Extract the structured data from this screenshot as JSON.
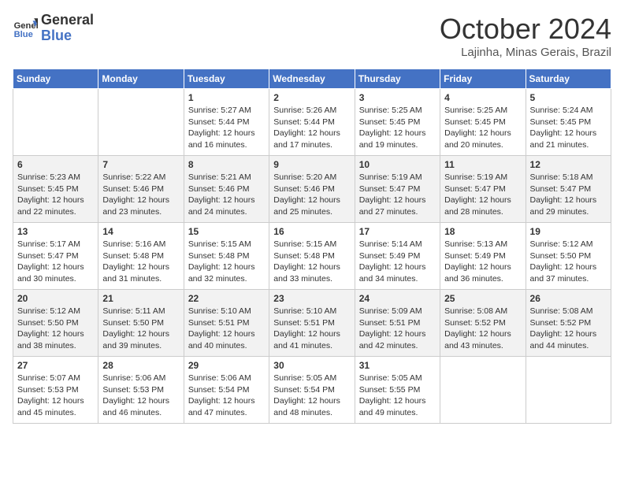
{
  "header": {
    "logo_line1": "General",
    "logo_line2": "Blue",
    "month": "October 2024",
    "location": "Lajinha, Minas Gerais, Brazil"
  },
  "days_of_week": [
    "Sunday",
    "Monday",
    "Tuesday",
    "Wednesday",
    "Thursday",
    "Friday",
    "Saturday"
  ],
  "weeks": [
    [
      {
        "day": "",
        "info": ""
      },
      {
        "day": "",
        "info": ""
      },
      {
        "day": "1",
        "info": "Sunrise: 5:27 AM\nSunset: 5:44 PM\nDaylight: 12 hours and 16 minutes."
      },
      {
        "day": "2",
        "info": "Sunrise: 5:26 AM\nSunset: 5:44 PM\nDaylight: 12 hours and 17 minutes."
      },
      {
        "day": "3",
        "info": "Sunrise: 5:25 AM\nSunset: 5:45 PM\nDaylight: 12 hours and 19 minutes."
      },
      {
        "day": "4",
        "info": "Sunrise: 5:25 AM\nSunset: 5:45 PM\nDaylight: 12 hours and 20 minutes."
      },
      {
        "day": "5",
        "info": "Sunrise: 5:24 AM\nSunset: 5:45 PM\nDaylight: 12 hours and 21 minutes."
      }
    ],
    [
      {
        "day": "6",
        "info": "Sunrise: 5:23 AM\nSunset: 5:45 PM\nDaylight: 12 hours and 22 minutes."
      },
      {
        "day": "7",
        "info": "Sunrise: 5:22 AM\nSunset: 5:46 PM\nDaylight: 12 hours and 23 minutes."
      },
      {
        "day": "8",
        "info": "Sunrise: 5:21 AM\nSunset: 5:46 PM\nDaylight: 12 hours and 24 minutes."
      },
      {
        "day": "9",
        "info": "Sunrise: 5:20 AM\nSunset: 5:46 PM\nDaylight: 12 hours and 25 minutes."
      },
      {
        "day": "10",
        "info": "Sunrise: 5:19 AM\nSunset: 5:47 PM\nDaylight: 12 hours and 27 minutes."
      },
      {
        "day": "11",
        "info": "Sunrise: 5:19 AM\nSunset: 5:47 PM\nDaylight: 12 hours and 28 minutes."
      },
      {
        "day": "12",
        "info": "Sunrise: 5:18 AM\nSunset: 5:47 PM\nDaylight: 12 hours and 29 minutes."
      }
    ],
    [
      {
        "day": "13",
        "info": "Sunrise: 5:17 AM\nSunset: 5:47 PM\nDaylight: 12 hours and 30 minutes."
      },
      {
        "day": "14",
        "info": "Sunrise: 5:16 AM\nSunset: 5:48 PM\nDaylight: 12 hours and 31 minutes."
      },
      {
        "day": "15",
        "info": "Sunrise: 5:15 AM\nSunset: 5:48 PM\nDaylight: 12 hours and 32 minutes."
      },
      {
        "day": "16",
        "info": "Sunrise: 5:15 AM\nSunset: 5:48 PM\nDaylight: 12 hours and 33 minutes."
      },
      {
        "day": "17",
        "info": "Sunrise: 5:14 AM\nSunset: 5:49 PM\nDaylight: 12 hours and 34 minutes."
      },
      {
        "day": "18",
        "info": "Sunrise: 5:13 AM\nSunset: 5:49 PM\nDaylight: 12 hours and 36 minutes."
      },
      {
        "day": "19",
        "info": "Sunrise: 5:12 AM\nSunset: 5:50 PM\nDaylight: 12 hours and 37 minutes."
      }
    ],
    [
      {
        "day": "20",
        "info": "Sunrise: 5:12 AM\nSunset: 5:50 PM\nDaylight: 12 hours and 38 minutes."
      },
      {
        "day": "21",
        "info": "Sunrise: 5:11 AM\nSunset: 5:50 PM\nDaylight: 12 hours and 39 minutes."
      },
      {
        "day": "22",
        "info": "Sunrise: 5:10 AM\nSunset: 5:51 PM\nDaylight: 12 hours and 40 minutes."
      },
      {
        "day": "23",
        "info": "Sunrise: 5:10 AM\nSunset: 5:51 PM\nDaylight: 12 hours and 41 minutes."
      },
      {
        "day": "24",
        "info": "Sunrise: 5:09 AM\nSunset: 5:51 PM\nDaylight: 12 hours and 42 minutes."
      },
      {
        "day": "25",
        "info": "Sunrise: 5:08 AM\nSunset: 5:52 PM\nDaylight: 12 hours and 43 minutes."
      },
      {
        "day": "26",
        "info": "Sunrise: 5:08 AM\nSunset: 5:52 PM\nDaylight: 12 hours and 44 minutes."
      }
    ],
    [
      {
        "day": "27",
        "info": "Sunrise: 5:07 AM\nSunset: 5:53 PM\nDaylight: 12 hours and 45 minutes."
      },
      {
        "day": "28",
        "info": "Sunrise: 5:06 AM\nSunset: 5:53 PM\nDaylight: 12 hours and 46 minutes."
      },
      {
        "day": "29",
        "info": "Sunrise: 5:06 AM\nSunset: 5:54 PM\nDaylight: 12 hours and 47 minutes."
      },
      {
        "day": "30",
        "info": "Sunrise: 5:05 AM\nSunset: 5:54 PM\nDaylight: 12 hours and 48 minutes."
      },
      {
        "day": "31",
        "info": "Sunrise: 5:05 AM\nSunset: 5:55 PM\nDaylight: 12 hours and 49 minutes."
      },
      {
        "day": "",
        "info": ""
      },
      {
        "day": "",
        "info": ""
      }
    ]
  ]
}
